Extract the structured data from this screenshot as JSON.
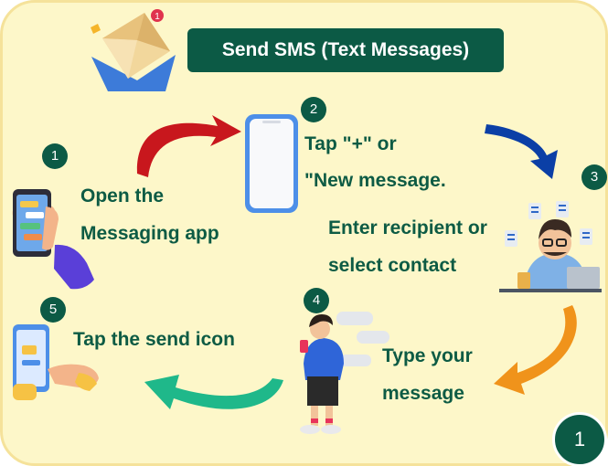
{
  "title": "Send SMS (Text Messages)",
  "steps": [
    {
      "number": "1",
      "line1": "Open the",
      "line2": "Messaging app"
    },
    {
      "number": "2",
      "line1": "Tap \"+\" or",
      "line2": "\"New message."
    },
    {
      "number": "3",
      "line1": "Enter recipient or",
      "line2": "select contact"
    },
    {
      "number": "4",
      "line1": "Type your",
      "line2": "message"
    },
    {
      "number": "5",
      "line1": "Tap the send icon"
    }
  ],
  "notification_count": "1",
  "page_number": "1",
  "colors": {
    "background": "#fdf7c9",
    "accent": "#0c5a45",
    "arrow_red": "#c8171d",
    "arrow_blue": "#0b3fa6",
    "arrow_orange": "#f0931b",
    "arrow_green": "#1fb88a"
  },
  "icons": [
    "envelope-icon",
    "hand-phone-icon",
    "blank-phone-icon",
    "person-laptop-icon",
    "person-typing-icon",
    "send-phone-icon"
  ]
}
